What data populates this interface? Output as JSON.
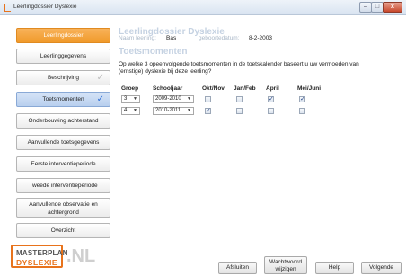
{
  "window": {
    "title": "Leerlingdossier Dyslexie",
    "minimize": "–",
    "maximize": "□",
    "close": "x"
  },
  "sidebar": {
    "items": [
      {
        "label": "Leerlingdossier"
      },
      {
        "label": "Leerlinggegevens"
      },
      {
        "label": "Beschrijving"
      },
      {
        "label": "Toetsmomenten"
      },
      {
        "label": "Onderbouwing achterstand"
      },
      {
        "label": "Aanvullende toetsgegevens"
      },
      {
        "label": "Eerste interventieperiode"
      },
      {
        "label": "Tweede interventieperiode"
      },
      {
        "label": "Aanvullende observatie en achtergrond"
      },
      {
        "label": "Overzicht"
      }
    ],
    "check": "✓"
  },
  "logo": {
    "line1": "MASTERPLAN",
    "line2": "DYSLEXIE",
    "suffix": ".NL",
    "accent_color": "#e8731c"
  },
  "main": {
    "heading": "Leerlingdossier Dyslexie",
    "name_label": "Naam leerling:",
    "name_value": "Bas",
    "dob_label": "geboortedatum:",
    "dob_value": "8-2-2003",
    "section_title": "Toetsmomenten",
    "question": "Op welke 3 opeenvolgende toetsmomenten in de toetskalender baseert u uw vermoeden van (ernstige) dyslexie bij deze leerling?"
  },
  "table": {
    "headers": {
      "groep": "Groep",
      "schooljaar": "Schooljaar",
      "okt_nov": "Okt/Nov",
      "jan_feb": "Jan/Feb",
      "april": "April",
      "mei_juni": "Mei/Juni"
    },
    "rows": [
      {
        "groep": "3",
        "schooljaar": "2009-2010",
        "okt_nov": false,
        "jan_feb": false,
        "april": true,
        "mei_juni": true
      },
      {
        "groep": "4",
        "schooljaar": "2010-2011",
        "okt_nov": true,
        "jan_feb": false,
        "april": false,
        "mei_juni": false
      }
    ],
    "check_glyph": "✓",
    "arrow_glyph": "▼"
  },
  "footer": {
    "afsluiten": "Afsluiten",
    "wachtwoord": "Wachtwoord wijzigen",
    "help": "Help",
    "volgende": "Volgende"
  }
}
